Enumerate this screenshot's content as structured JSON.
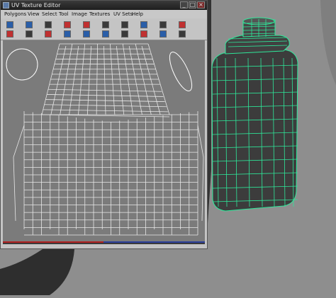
{
  "editor": {
    "title": "UV Texture Editor",
    "window_buttons": {
      "minimize": "_",
      "maximize": "□",
      "close": "×"
    }
  },
  "menu": [
    "Polygons",
    "View",
    "Select",
    "Tool",
    "Image",
    "Textures",
    "UV Sets",
    "Help"
  ],
  "toolbar": {
    "icon_names": [
      "move-uv-icon",
      "rotate-uv-icon",
      "scale-uv-icon",
      "flip-u-icon",
      "flip-v-icon",
      "rotate-ccw-icon",
      "rotate-cw-icon",
      "cut-uv-icon",
      "sew-uv-icon",
      "move-sew-icon",
      "layout-icon",
      "unfold-icon",
      "relax-icon",
      "align-icon",
      "grid-icon",
      "snapshot-icon",
      "checker-icon",
      "display-image-icon",
      "filter-icon",
      "dim-image-icon"
    ]
  },
  "colors": {
    "viewport_bg": "#8e8e8e",
    "editor_bg": "#c4c4c4",
    "uv_bg": "#7b7b7b",
    "uv_wire": "#ffffff",
    "object_body": "#3a3a3a",
    "object_wire": "#2ee89a"
  }
}
